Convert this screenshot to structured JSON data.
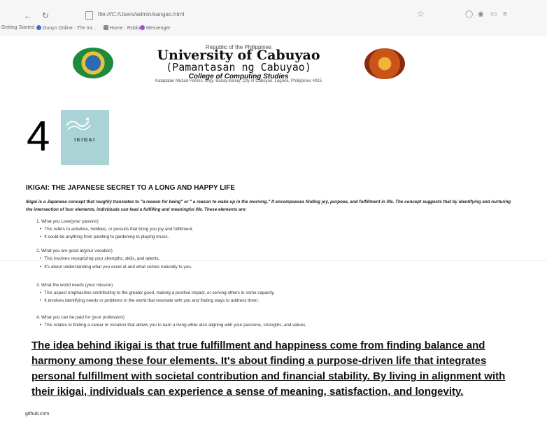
{
  "browser": {
    "url": "file:///C:/Users/admin/sangao.html",
    "bookmarks": [
      "Getting Started",
      "Gonyo Online · The Int...",
      "Home · Roblox",
      "Messenger"
    ]
  },
  "header": {
    "republic": "Republic of the Philippines",
    "university": "University of Cabuyao",
    "subtitle": "(Pamantasan ng Cabuyao)",
    "college": "College of Computing Studies",
    "address": "Katapatan Mutual Homes, Brgy. Banay-banay, City of Cabuyao, Laguna, Philippines 4025"
  },
  "entry_number": "4",
  "book": {
    "title": "IKIGAI"
  },
  "article": {
    "title": "IKIGAI: THE JAPANESE SECRET TO A LONG AND HAPPY LIFE",
    "intro": "Ikigai is a Japanese concept that roughly translates to \"a reason for being\" or \" a reason to wake up in the morning.\" It encompasses finding joy, purpose, and fulfillment in life. The concept suggests that by identifying and nurturing the intersection of four elements, individuals can lead a fulfilling and meaningful life. These elements are:",
    "elements": [
      {
        "title": "1. What you Love(your passion)",
        "points": [
          "This refers to activities, hobbies, or pursuits that bring you joy and fulfillment.",
          "It could be anything from painting to gardening to playing music."
        ]
      },
      {
        "title": "2. What you are good at(your vocation)",
        "points": [
          "This involves recognizing your strengths, skills, and talents.",
          "It's about understanding what you excel at and what comes naturally to you."
        ]
      },
      {
        "title": "3. What the world needs (your mission)",
        "points": [
          "This aspect emphasizes contributing to the greater good, making a positive impact, or serving others in some capacity.",
          "It involves identifying needs or problems in the world that resonate with you and finding ways to address them."
        ]
      },
      {
        "title": "4. What you can be paid for (your profession)",
        "points": [
          "This relates to finding a career or vocation that allows you to earn a living while also aligning with your passions, strengths, and values."
        ]
      }
    ],
    "closing": "The idea behind ikigai is that true fulfillment and happiness come from finding balance and harmony among these four elements. It's about finding a purpose-driven life that integrates personal fulfillment with societal contribution and financial stability. By living in alignment with their ikigai, individuals can experience a sense of meaning, satisfaction, and longevity."
  },
  "footer": "github.com"
}
